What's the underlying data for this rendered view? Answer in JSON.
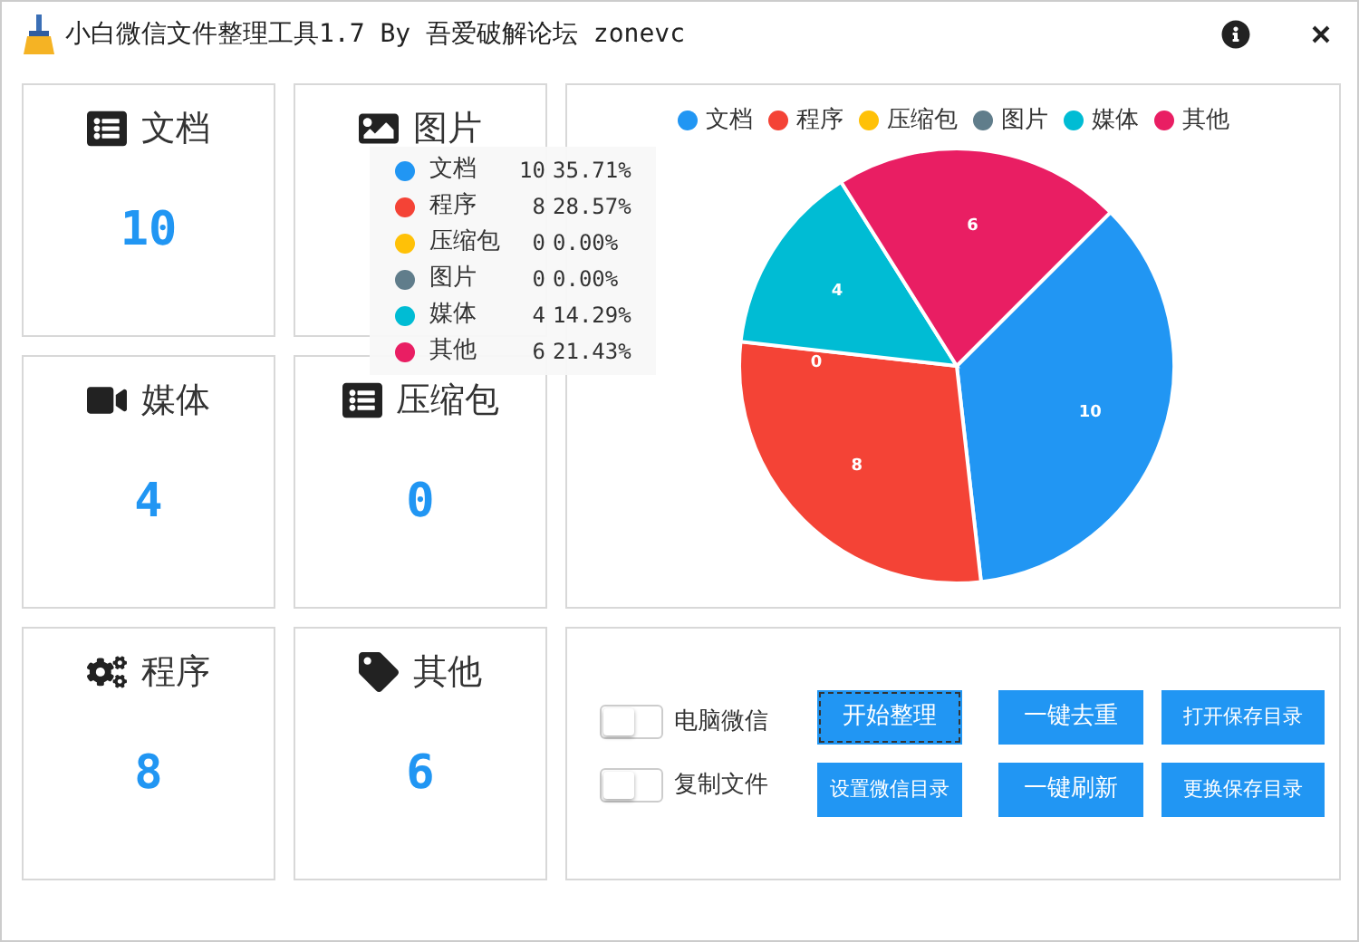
{
  "window": {
    "title": "小白微信文件整理工具1.7 By 吾爱破解论坛 zonevc"
  },
  "cards": [
    {
      "label": "文档",
      "count": "10"
    },
    {
      "label": "图片"
    },
    {
      "label": "媒体",
      "count": "4"
    },
    {
      "label": "压缩包",
      "count": "0"
    },
    {
      "label": "程序",
      "count": "8"
    },
    {
      "label": "其他",
      "count": "6"
    }
  ],
  "chart": {
    "chart_data": {
      "type": "pie",
      "legend": "top",
      "value_labels": [
        "10",
        "8",
        "0",
        null,
        "4",
        "6"
      ],
      "categories": [
        "文档",
        "程序",
        "压缩包",
        "图片",
        "媒体",
        "其他"
      ],
      "values": [
        10,
        8,
        0,
        0,
        4,
        6
      ]
    },
    "slices": [
      {
        "color": "#2196f3"
      },
      {
        "color": "#f44336"
      },
      {
        "color": "#ffc107"
      },
      {
        "color": "#607d8b"
      },
      {
        "color": "#00bcd4"
      },
      {
        "color": "#e91e63"
      }
    ],
    "tooltip": [
      {
        "name": "文档",
        "value": "10",
        "percent": "35.71%",
        "color": "#2196f3"
      },
      {
        "name": "程序",
        "value": "8",
        "percent": "28.57%",
        "color": "#f44336"
      },
      {
        "name": "压缩包",
        "value": "0",
        "percent": "0.00%",
        "color": "#ffc107"
      },
      {
        "name": "图片",
        "value": "0",
        "percent": "0.00%",
        "color": "#607d8b"
      },
      {
        "name": "媒体",
        "value": "4",
        "percent": "14.29%",
        "color": "#00bcd4"
      },
      {
        "name": "其他",
        "value": "6",
        "percent": "21.43%",
        "color": "#e91e63"
      }
    ]
  },
  "switches": [
    {
      "label": "电脑微信",
      "on": false
    },
    {
      "label": "复制文件",
      "on": false
    }
  ],
  "buttons": [
    {
      "label": "开始整理",
      "focused": true
    },
    {
      "label": "一键去重",
      "focused": false
    },
    {
      "label": "打开保存目录",
      "focused": false
    },
    {
      "label": "设置微信目录",
      "focused": false
    },
    {
      "label": "一键刷新",
      "focused": false
    },
    {
      "label": "更换保存目录",
      "focused": false
    }
  ]
}
